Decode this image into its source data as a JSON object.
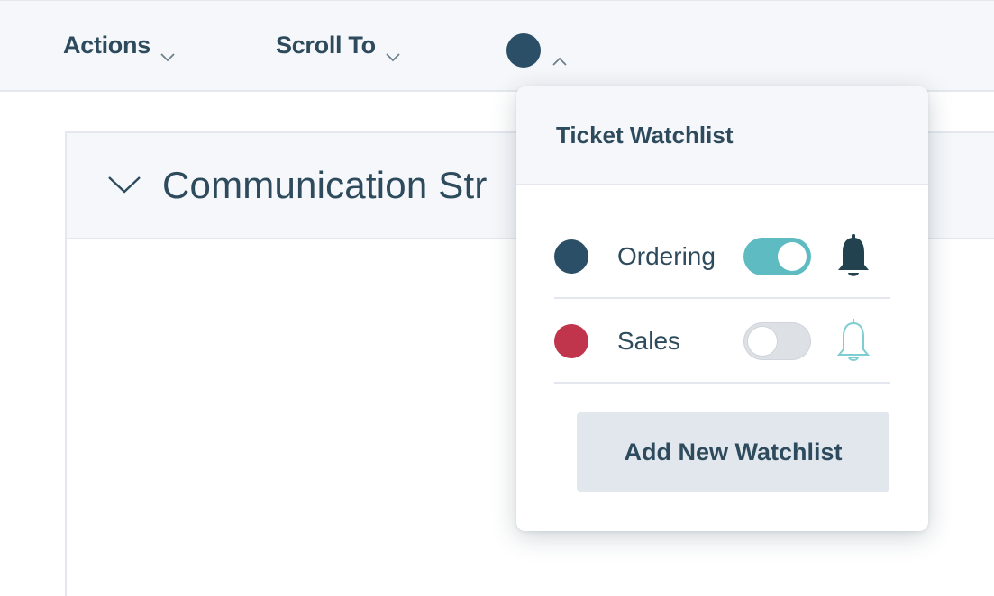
{
  "toolbar": {
    "actions_label": "Actions",
    "scroll_to_label": "Scroll To",
    "watchlist_indicator_color": "#2b4f66"
  },
  "widget": {
    "title": "Communication Str"
  },
  "watchlist_popup": {
    "title": "Ticket Watchlist",
    "items": [
      {
        "label": "Ordering",
        "color": "#2b4f66",
        "enabled": true,
        "notification_icon": "bell-filled-icon"
      },
      {
        "label": "Sales",
        "color": "#c0354b",
        "enabled": false,
        "notification_icon": "bell-outline-icon"
      }
    ],
    "add_button_label": "Add New Watchlist"
  },
  "colors": {
    "toggle_on": "#5dbbc1",
    "toggle_off": "#dde1e6",
    "text": "#2d4b5c",
    "bell_outline": "#7ecdd2"
  }
}
